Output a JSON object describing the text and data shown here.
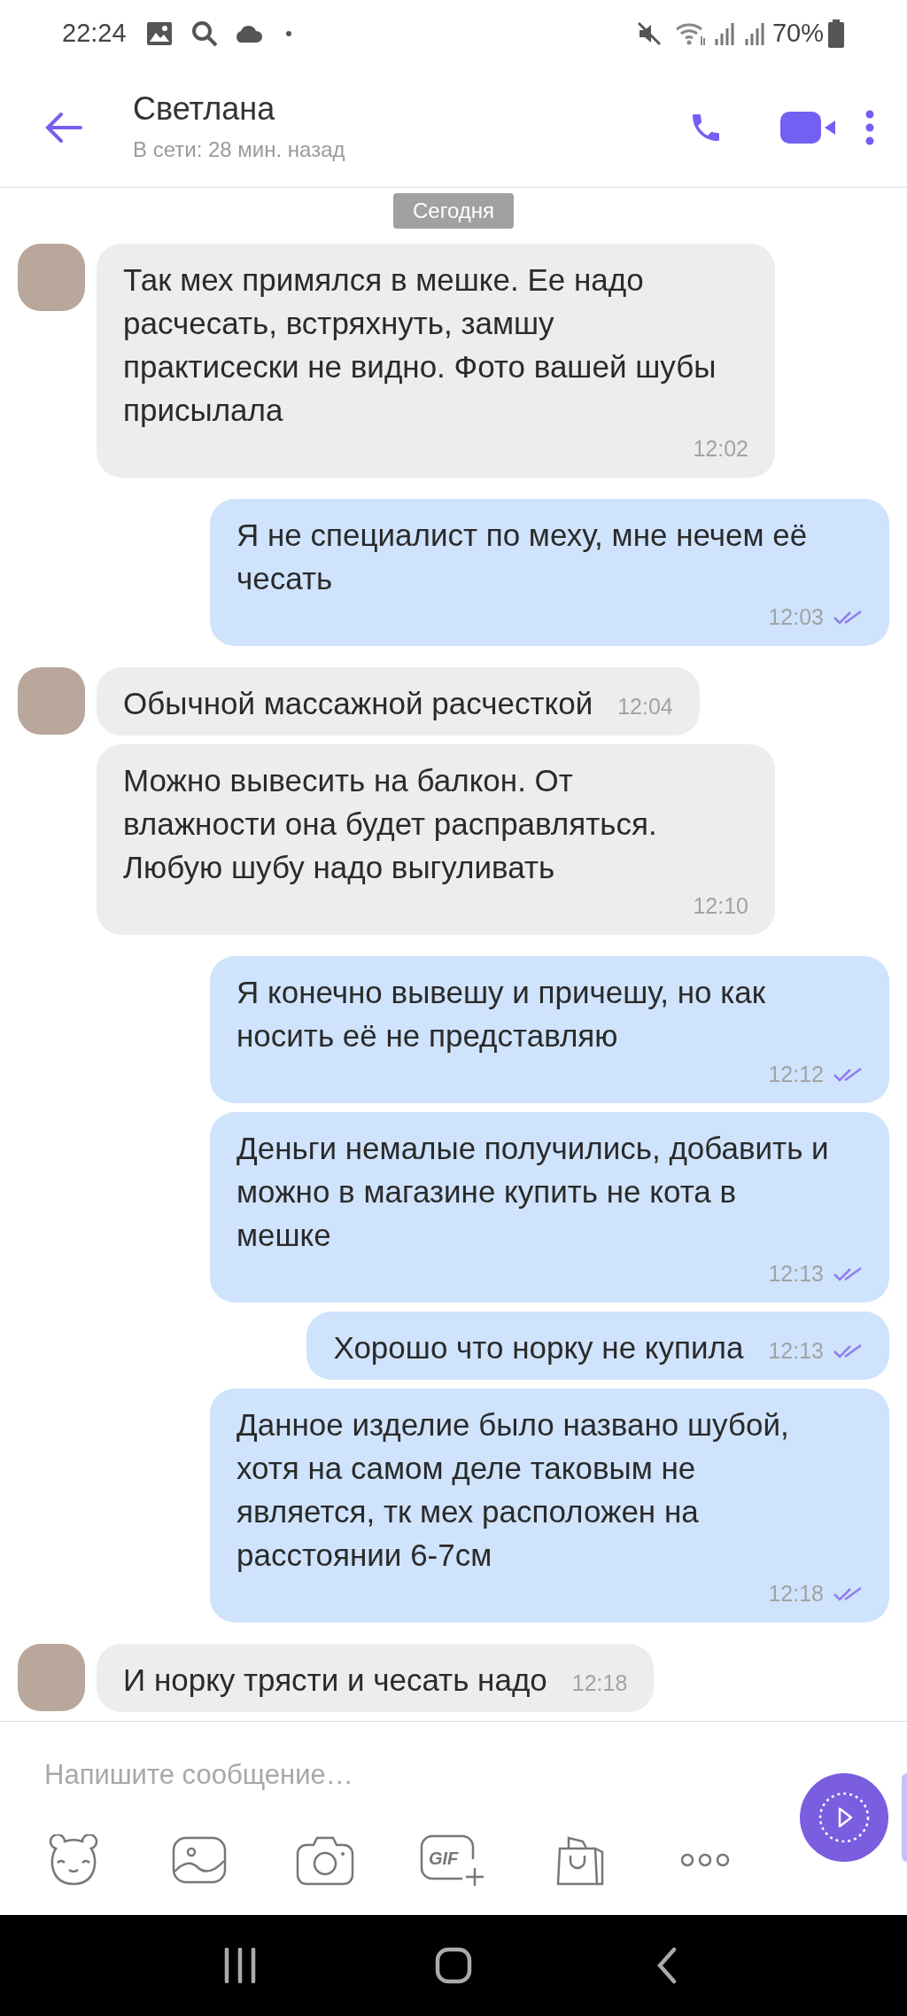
{
  "status_bar": {
    "time": "22:24",
    "battery": "70%"
  },
  "header": {
    "name": "Светлана",
    "subtitle": "В сети: 28 мин. назад"
  },
  "date_label": "Сегодня",
  "messages": [
    {
      "kind": "incoming",
      "show_avatar": true,
      "text": "Так мех примялся в мешке. Ее надо расчесать, встряхнуть, замшу практисески не видно. Фото вашей шубы присылала",
      "time": "12:02"
    },
    {
      "kind": "outgoing",
      "read": true,
      "text": "Я не специалист по меху, мне нечем её чесать",
      "time": "12:03"
    },
    {
      "kind": "incoming",
      "show_avatar": true,
      "text": "Обычной массажной расчесткой",
      "time": "12:04"
    },
    {
      "kind": "incoming",
      "show_avatar": false,
      "text": "Можно вывесить на балкон. От влажности она будет расправляться. Любую шубу надо выгуливать",
      "time": "12:10"
    },
    {
      "kind": "outgoing",
      "read": true,
      "text": "Я конечно вывешу и причешу, но как носить её не представляю",
      "time": "12:12"
    },
    {
      "kind": "outgoing",
      "read": true,
      "text": "Деньги немалые получились, добавить и можно в магазине купить не кота в мешке",
      "time": "12:13"
    },
    {
      "kind": "outgoing",
      "read": true,
      "text": "Хорошо что норку не купила",
      "time": "12:13"
    },
    {
      "kind": "outgoing",
      "read": true,
      "text": "Данное изделие было названо шубой, хотя на самом деле таковым не является,  тк мех расположен на расстоянии 6-7см",
      "time": "12:18"
    },
    {
      "kind": "incoming",
      "show_avatar": true,
      "text": "И норку трясти и чесать надо",
      "time": "12:18"
    }
  ],
  "composer": {
    "placeholder": "Напишите сообщение…",
    "gif_label": "GIF"
  }
}
